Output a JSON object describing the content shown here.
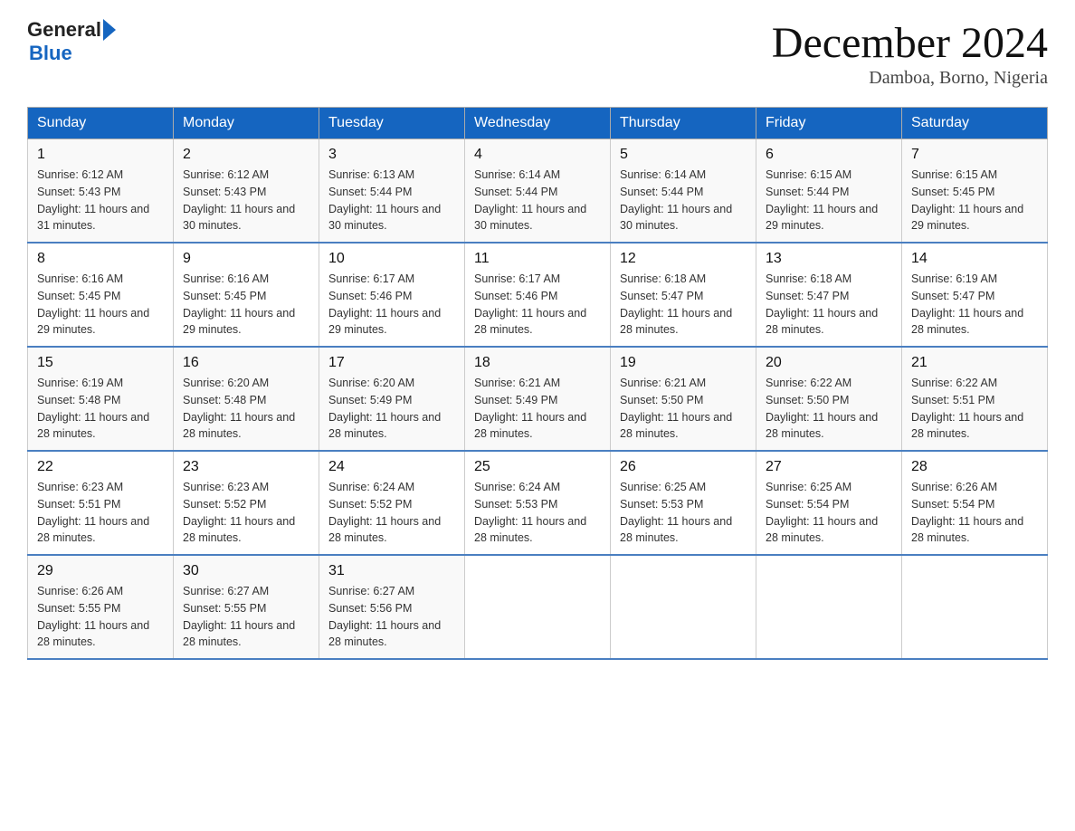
{
  "header": {
    "logo_general": "General",
    "logo_blue": "Blue",
    "month_title": "December 2024",
    "location": "Damboa, Borno, Nigeria"
  },
  "weekdays": [
    "Sunday",
    "Monday",
    "Tuesday",
    "Wednesday",
    "Thursday",
    "Friday",
    "Saturday"
  ],
  "weeks": [
    [
      {
        "day": "1",
        "sunrise": "6:12 AM",
        "sunset": "5:43 PM",
        "daylight": "11 hours and 31 minutes."
      },
      {
        "day": "2",
        "sunrise": "6:12 AM",
        "sunset": "5:43 PM",
        "daylight": "11 hours and 30 minutes."
      },
      {
        "day": "3",
        "sunrise": "6:13 AM",
        "sunset": "5:44 PM",
        "daylight": "11 hours and 30 minutes."
      },
      {
        "day": "4",
        "sunrise": "6:14 AM",
        "sunset": "5:44 PM",
        "daylight": "11 hours and 30 minutes."
      },
      {
        "day": "5",
        "sunrise": "6:14 AM",
        "sunset": "5:44 PM",
        "daylight": "11 hours and 30 minutes."
      },
      {
        "day": "6",
        "sunrise": "6:15 AM",
        "sunset": "5:44 PM",
        "daylight": "11 hours and 29 minutes."
      },
      {
        "day": "7",
        "sunrise": "6:15 AM",
        "sunset": "5:45 PM",
        "daylight": "11 hours and 29 minutes."
      }
    ],
    [
      {
        "day": "8",
        "sunrise": "6:16 AM",
        "sunset": "5:45 PM",
        "daylight": "11 hours and 29 minutes."
      },
      {
        "day": "9",
        "sunrise": "6:16 AM",
        "sunset": "5:45 PM",
        "daylight": "11 hours and 29 minutes."
      },
      {
        "day": "10",
        "sunrise": "6:17 AM",
        "sunset": "5:46 PM",
        "daylight": "11 hours and 29 minutes."
      },
      {
        "day": "11",
        "sunrise": "6:17 AM",
        "sunset": "5:46 PM",
        "daylight": "11 hours and 28 minutes."
      },
      {
        "day": "12",
        "sunrise": "6:18 AM",
        "sunset": "5:47 PM",
        "daylight": "11 hours and 28 minutes."
      },
      {
        "day": "13",
        "sunrise": "6:18 AM",
        "sunset": "5:47 PM",
        "daylight": "11 hours and 28 minutes."
      },
      {
        "day": "14",
        "sunrise": "6:19 AM",
        "sunset": "5:47 PM",
        "daylight": "11 hours and 28 minutes."
      }
    ],
    [
      {
        "day": "15",
        "sunrise": "6:19 AM",
        "sunset": "5:48 PM",
        "daylight": "11 hours and 28 minutes."
      },
      {
        "day": "16",
        "sunrise": "6:20 AM",
        "sunset": "5:48 PM",
        "daylight": "11 hours and 28 minutes."
      },
      {
        "day": "17",
        "sunrise": "6:20 AM",
        "sunset": "5:49 PM",
        "daylight": "11 hours and 28 minutes."
      },
      {
        "day": "18",
        "sunrise": "6:21 AM",
        "sunset": "5:49 PM",
        "daylight": "11 hours and 28 minutes."
      },
      {
        "day": "19",
        "sunrise": "6:21 AM",
        "sunset": "5:50 PM",
        "daylight": "11 hours and 28 minutes."
      },
      {
        "day": "20",
        "sunrise": "6:22 AM",
        "sunset": "5:50 PM",
        "daylight": "11 hours and 28 minutes."
      },
      {
        "day": "21",
        "sunrise": "6:22 AM",
        "sunset": "5:51 PM",
        "daylight": "11 hours and 28 minutes."
      }
    ],
    [
      {
        "day": "22",
        "sunrise": "6:23 AM",
        "sunset": "5:51 PM",
        "daylight": "11 hours and 28 minutes."
      },
      {
        "day": "23",
        "sunrise": "6:23 AM",
        "sunset": "5:52 PM",
        "daylight": "11 hours and 28 minutes."
      },
      {
        "day": "24",
        "sunrise": "6:24 AM",
        "sunset": "5:52 PM",
        "daylight": "11 hours and 28 minutes."
      },
      {
        "day": "25",
        "sunrise": "6:24 AM",
        "sunset": "5:53 PM",
        "daylight": "11 hours and 28 minutes."
      },
      {
        "day": "26",
        "sunrise": "6:25 AM",
        "sunset": "5:53 PM",
        "daylight": "11 hours and 28 minutes."
      },
      {
        "day": "27",
        "sunrise": "6:25 AM",
        "sunset": "5:54 PM",
        "daylight": "11 hours and 28 minutes."
      },
      {
        "day": "28",
        "sunrise": "6:26 AM",
        "sunset": "5:54 PM",
        "daylight": "11 hours and 28 minutes."
      }
    ],
    [
      {
        "day": "29",
        "sunrise": "6:26 AM",
        "sunset": "5:55 PM",
        "daylight": "11 hours and 28 minutes."
      },
      {
        "day": "30",
        "sunrise": "6:27 AM",
        "sunset": "5:55 PM",
        "daylight": "11 hours and 28 minutes."
      },
      {
        "day": "31",
        "sunrise": "6:27 AM",
        "sunset": "5:56 PM",
        "daylight": "11 hours and 28 minutes."
      },
      null,
      null,
      null,
      null
    ]
  ]
}
